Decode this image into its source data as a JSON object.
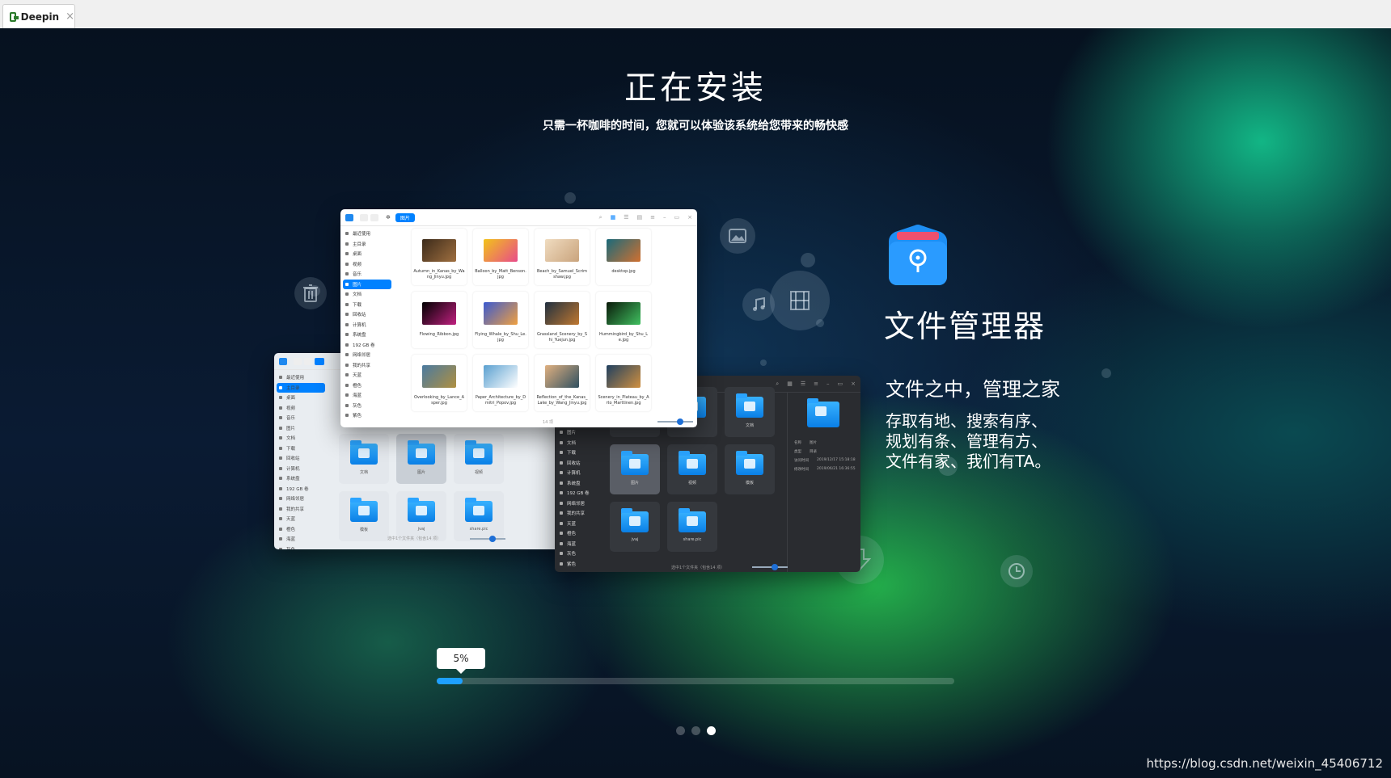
{
  "host_tab": {
    "label": "Deepin",
    "close": "×"
  },
  "installer": {
    "title": "正在安装",
    "subtitle": "只需一杯咖啡的时间，您就可以体验该系统给您带来的畅快感",
    "feature": {
      "app_name": "文件管理器",
      "slogan": "文件之中，管理之家",
      "description": "存取有地、搜索有序、\n规划有条、管理有方、\n文件有家、我们有TA。"
    },
    "progress": {
      "label": "5%",
      "percent": 5
    },
    "pager": {
      "count": 3,
      "active": 2
    }
  },
  "fm_light": {
    "breadcrumb": "图片",
    "sidebar": [
      {
        "label": "最近使用"
      },
      {
        "label": "主目录"
      },
      {
        "label": "桌面"
      },
      {
        "label": "视频"
      },
      {
        "label": "音乐"
      },
      {
        "label": "图片",
        "active": true
      },
      {
        "label": "文档"
      },
      {
        "label": "下载"
      },
      {
        "label": "回收站"
      },
      {
        "label": "计算机"
      },
      {
        "label": "系统盘"
      },
      {
        "label": "192 GB 卷"
      },
      {
        "label": "网络邻居"
      },
      {
        "label": "我的共享"
      },
      {
        "label": "天蓝"
      },
      {
        "label": "橙色"
      },
      {
        "label": "海蓝"
      },
      {
        "label": "灰色"
      },
      {
        "label": "紫色"
      }
    ],
    "files": [
      {
        "name": "Autumn_in_Kanas_by_Wang_Jinyu.jpg",
        "colors": [
          "#3b2a1a",
          "#a07040"
        ]
      },
      {
        "name": "Balloon_by_Matt_Benson.jpg",
        "colors": [
          "#f2c31a",
          "#e84b8a"
        ]
      },
      {
        "name": "Beach_by_Samuel_Scrimshaw.jpg",
        "colors": [
          "#f0dcc0",
          "#c9a37c"
        ]
      },
      {
        "name": "desktop.jpg",
        "colors": [
          "#1a6a7a",
          "#d07030"
        ]
      },
      {
        "name": "Flowing_Ribbon.jpg",
        "colors": [
          "#000000",
          "#c02080"
        ]
      },
      {
        "name": "Flying_Whale_by_Shu_Le.jpg",
        "colors": [
          "#3a5ad0",
          "#f0a040"
        ]
      },
      {
        "name": "Grassland_Scenery_by_Shi_Yuejun.jpg",
        "colors": [
          "#203040",
          "#c07830"
        ]
      },
      {
        "name": "Hummingbird_by_Shu_Le.jpg",
        "colors": [
          "#0a1a0a",
          "#40c060"
        ]
      },
      {
        "name": "Overlooking_by_Lance_Asper.jpg",
        "colors": [
          "#4a7aa0",
          "#b09040"
        ]
      },
      {
        "name": "Paper_Architecture_by_Dmitri_Popov.jpg",
        "colors": [
          "#5aa0d0",
          "#ffffff"
        ]
      },
      {
        "name": "Reflection_of_the_Kanas_Lake_by_Wang_Jinyu.jpg",
        "colors": [
          "#e0b080",
          "#305060"
        ]
      },
      {
        "name": "Scenery_in_Plateau_by_Arto_Marttinen.jpg",
        "colors": [
          "#204060",
          "#d09040"
        ]
      }
    ],
    "status": "14 项"
  },
  "fm_dark": {
    "sidebar": [
      {
        "label": "图片"
      },
      {
        "label": "文档"
      },
      {
        "label": "下载"
      },
      {
        "label": "回收站"
      },
      {
        "label": "计算机"
      },
      {
        "label": "系统盘"
      },
      {
        "label": "192 GB 卷"
      },
      {
        "label": "网络邻居"
      },
      {
        "label": "我的共享"
      },
      {
        "label": "天蓝"
      },
      {
        "label": "橙色"
      },
      {
        "label": "海蓝"
      },
      {
        "label": "灰色"
      },
      {
        "label": "紫色"
      }
    ],
    "folders": [
      {
        "label": ""
      },
      {
        "label": "下载"
      },
      {
        "label": "文档"
      },
      {
        "label": "图片",
        "selected": true
      },
      {
        "label": "视频"
      },
      {
        "label": "模板"
      },
      {
        "label": "jvaj"
      },
      {
        "label": "share.pic"
      }
    ],
    "detail": [
      {
        "k": "名称",
        "v": "图片"
      },
      {
        "k": "类型",
        "v": "目录"
      },
      {
        "k": "访问时间",
        "v": "2019/12/17 15:18:18"
      },
      {
        "k": "修改时间",
        "v": "2019/06/21 16:36:55"
      }
    ],
    "status": "选中1个文件夹（包含14 项）"
  },
  "fm_back": {
    "sidebar": [
      {
        "label": "最近使用"
      },
      {
        "label": "主目录",
        "active": true
      },
      {
        "label": "桌面"
      },
      {
        "label": "视频"
      },
      {
        "label": "音乐"
      },
      {
        "label": "图片"
      },
      {
        "label": "文档"
      },
      {
        "label": "下载"
      },
      {
        "label": "回收站"
      },
      {
        "label": "计算机"
      },
      {
        "label": "系统盘"
      },
      {
        "label": "192 GB 卷"
      },
      {
        "label": "网络邻居"
      },
      {
        "label": "我的共享"
      },
      {
        "label": "天蓝"
      },
      {
        "label": "橙色"
      },
      {
        "label": "海蓝"
      },
      {
        "label": "灰色"
      },
      {
        "label": "紫色"
      }
    ],
    "folders": [
      {
        "label": "文档"
      },
      {
        "label": "图片",
        "selected": true
      },
      {
        "label": "视频"
      },
      {
        "label": "模板"
      },
      {
        "label": "jvaj"
      },
      {
        "label": "share.pic"
      }
    ],
    "status": "选中1个文件夹（包含14 项）"
  },
  "watermark": "https://blog.csdn.net/weixin_45406712",
  "colors": {
    "accent": "#0081ff",
    "progress": "#1ea0ff"
  }
}
